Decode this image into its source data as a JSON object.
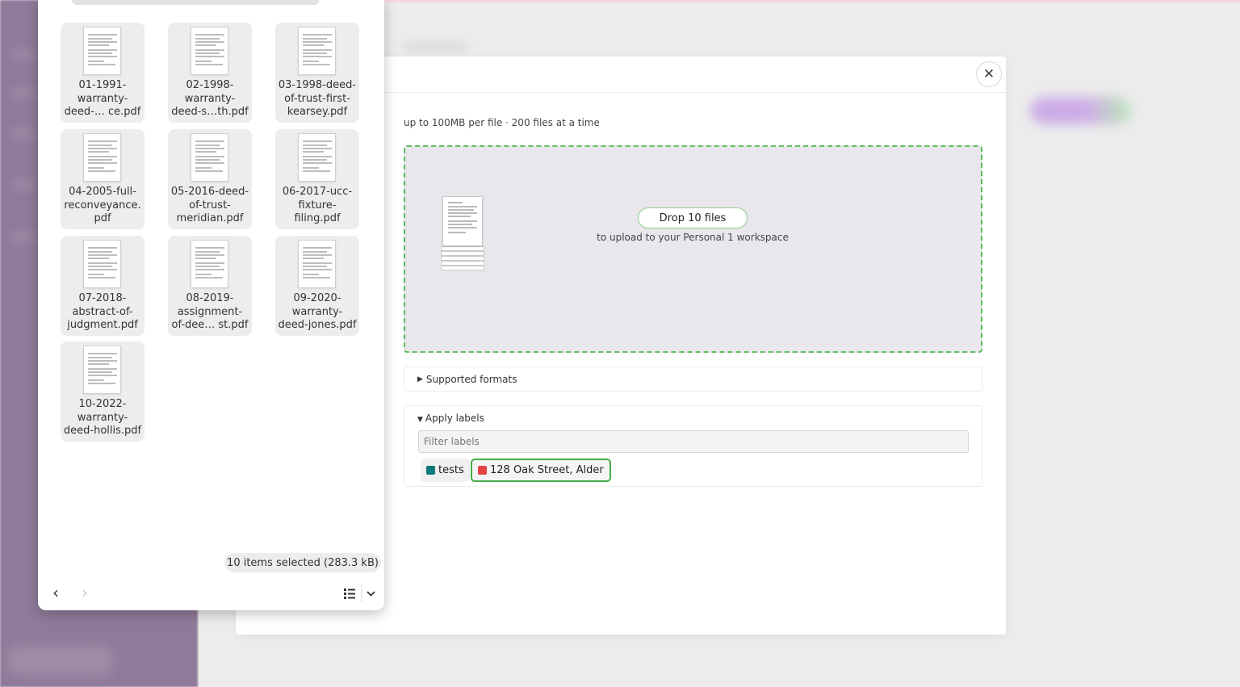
{
  "dialog": {
    "close_icon": "close-icon",
    "limits_text": "up to 100MB per file · 200 files at a time",
    "dropzone": {
      "icon": "document-stack-icon",
      "button_label": "Drop 10 files",
      "subtitle": "to upload to your Personal 1 workspace",
      "border_color": "#5bbf5b"
    },
    "formats": {
      "label": "Supported formats",
      "expanded": false
    },
    "labels": {
      "title": "Apply labels",
      "expanded": true,
      "filter_placeholder": "Filter labels",
      "filter_value": "",
      "chips": [
        {
          "name": "tests",
          "color": "#0f7a7a",
          "selected": false
        },
        {
          "name": "128 Oak Street, Alder",
          "color": "#e24444",
          "selected": true
        }
      ]
    }
  },
  "chooser": {
    "files": [
      {
        "name": "01-1991-\nwarranty-\ndeed-… ce.pdf"
      },
      {
        "name": "02-1998-\nwarranty-\ndeed-s…th.pdf"
      },
      {
        "name": "03-1998-deed-\nof-trust-first-\nkearsey.pdf"
      },
      {
        "name": "04-2005-full-\nreconveyance.\npdf"
      },
      {
        "name": "05-2016-deed-\nof-trust-\nmeridian.pdf"
      },
      {
        "name": "06-2017-ucc-\nfixture-\nfiling.pdf"
      },
      {
        "name": "07-2018-\nabstract-of-\njudgment.pdf"
      },
      {
        "name": "08-2019-\nassignment-\nof-dee… st.pdf"
      },
      {
        "name": "09-2020-\nwarranty-\ndeed-jones.pdf"
      },
      {
        "name": "10-2022-\nwarranty-\ndeed-hollis.pdf"
      }
    ],
    "selection_summary": "10 items selected  (283.3 kB)",
    "nav": {
      "back_icon": "chevron-left-icon",
      "forward_icon": "chevron-right-icon"
    },
    "view": {
      "list_icon": "list-view-icon",
      "dropdown_icon": "chevron-down-icon"
    }
  }
}
